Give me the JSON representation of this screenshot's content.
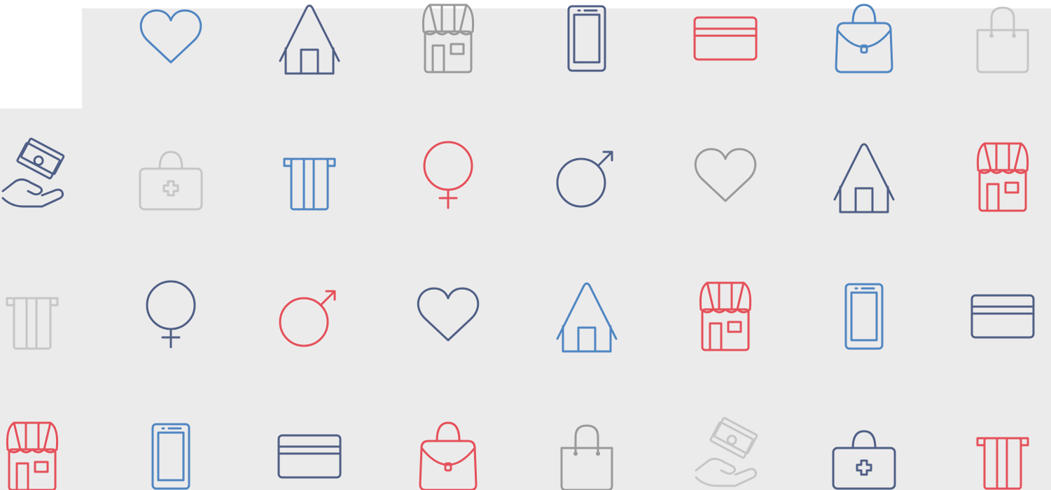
{
  "colors": {
    "background": "#ecebeb",
    "blue": "#4f86c2",
    "navy": "#4f5f86",
    "red": "#e5505a",
    "gray": "#9a9a9a",
    "light": "#c6c6c6"
  },
  "rows": [
    [
      {
        "icon": "heart",
        "color": "blue"
      },
      {
        "icon": "house",
        "color": "navy"
      },
      {
        "icon": "store",
        "color": "gray"
      },
      {
        "icon": "smartphone",
        "color": "navy"
      },
      {
        "icon": "credit-card",
        "color": "red"
      },
      {
        "icon": "handbag",
        "color": "blue"
      },
      {
        "icon": "shopping-bag",
        "color": "light"
      }
    ],
    [
      {
        "icon": "hand-money",
        "color": "navy"
      },
      {
        "icon": "medical-kit",
        "color": "light"
      },
      {
        "icon": "atm-card",
        "color": "blue"
      },
      {
        "icon": "female-symbol",
        "color": "red"
      },
      {
        "icon": "male-symbol",
        "color": "navy"
      },
      {
        "icon": "heart",
        "color": "gray"
      },
      {
        "icon": "house",
        "color": "navy"
      },
      {
        "icon": "store",
        "color": "red"
      }
    ],
    [
      {
        "icon": "atm-card",
        "color": "light"
      },
      {
        "icon": "female-symbol",
        "color": "navy"
      },
      {
        "icon": "male-symbol",
        "color": "red"
      },
      {
        "icon": "heart",
        "color": "navy"
      },
      {
        "icon": "house",
        "color": "blue"
      },
      {
        "icon": "store",
        "color": "red"
      },
      {
        "icon": "smartphone",
        "color": "blue"
      },
      {
        "icon": "credit-card",
        "color": "navy"
      }
    ],
    [
      {
        "icon": "store",
        "color": "red"
      },
      {
        "icon": "smartphone",
        "color": "blue"
      },
      {
        "icon": "credit-card",
        "color": "navy"
      },
      {
        "icon": "handbag",
        "color": "red"
      },
      {
        "icon": "shopping-bag",
        "color": "gray"
      },
      {
        "icon": "hand-money",
        "color": "light"
      },
      {
        "icon": "medical-kit",
        "color": "navy"
      },
      {
        "icon": "atm-card",
        "color": "red"
      }
    ]
  ]
}
